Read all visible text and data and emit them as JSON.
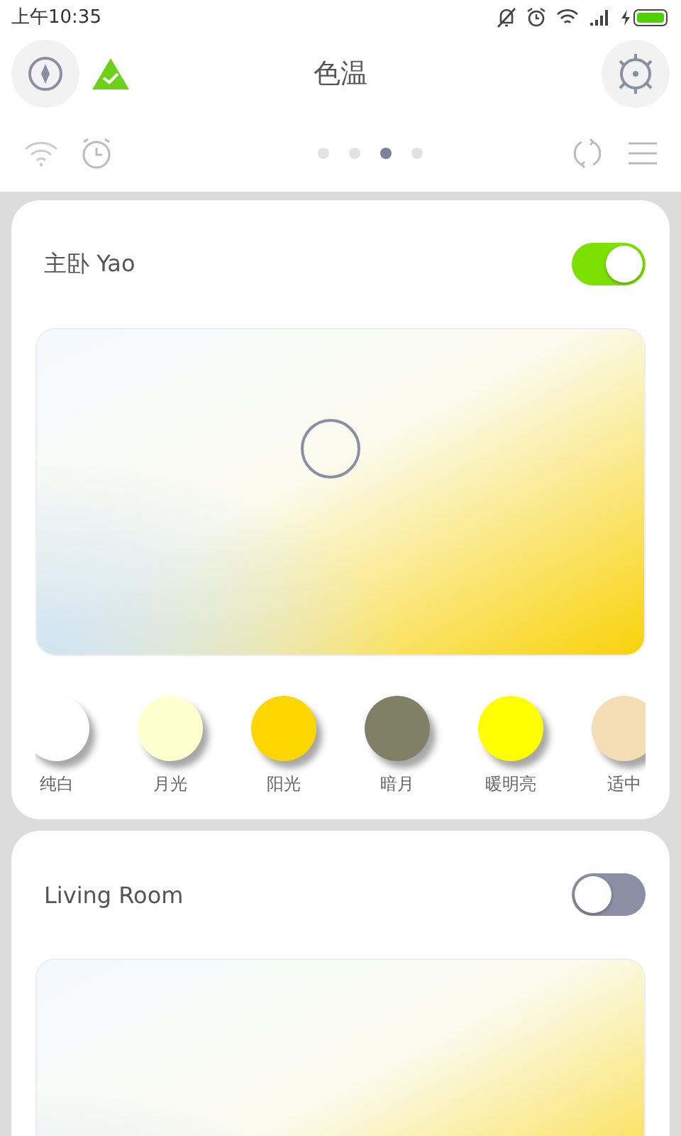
{
  "status_bar": {
    "time": "上午10:35"
  },
  "header": {
    "title": "色温"
  },
  "pager": {
    "dots": [
      {
        "selected": false
      },
      {
        "selected": false
      },
      {
        "selected": true
      },
      {
        "selected": false
      }
    ]
  },
  "rooms": [
    {
      "name": "主卧 Yao",
      "on": true,
      "presets": [
        {
          "label": "纯白",
          "color": "#ffffff"
        },
        {
          "label": "月光",
          "color": "#ffffd0"
        },
        {
          "label": "阳光",
          "color": "#ffd700"
        },
        {
          "label": "暗月",
          "color": "#808066"
        },
        {
          "label": "暖明亮",
          "color": "#ffff00"
        },
        {
          "label": "适中",
          "color": "#f5deb3"
        }
      ]
    },
    {
      "name": "Living Room",
      "on": false
    }
  ]
}
